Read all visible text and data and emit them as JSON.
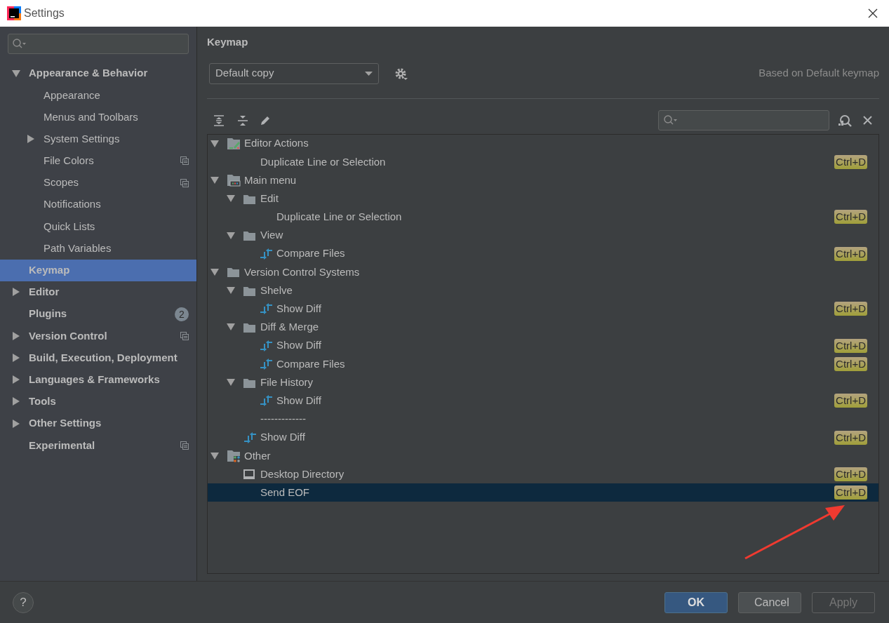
{
  "window": {
    "title": "Settings"
  },
  "sidebar": {
    "items": [
      {
        "label": "Appearance & Behavior",
        "expanded": true,
        "selected": false,
        "children": [
          {
            "label": "Appearance",
            "selected": false
          },
          {
            "label": "Menus and Toolbars",
            "selected": false
          },
          {
            "label": "System Settings",
            "expanded": false,
            "selected": false
          },
          {
            "label": "File Colors",
            "selected": false,
            "project_level": true
          },
          {
            "label": "Scopes",
            "selected": false,
            "project_level": true
          },
          {
            "label": "Notifications",
            "selected": false
          },
          {
            "label": "Quick Lists",
            "selected": false
          },
          {
            "label": "Path Variables",
            "selected": false
          }
        ]
      },
      {
        "label": "Keymap",
        "selected": true
      },
      {
        "label": "Editor",
        "expanded": false,
        "selected": false
      },
      {
        "label": "Plugins",
        "selected": false,
        "badge": "2"
      },
      {
        "label": "Version Control",
        "expanded": false,
        "selected": false,
        "project_level": true
      },
      {
        "label": "Build, Execution, Deployment",
        "expanded": false,
        "selected": false
      },
      {
        "label": "Languages & Frameworks",
        "expanded": false,
        "selected": false
      },
      {
        "label": "Tools",
        "expanded": false,
        "selected": false
      },
      {
        "label": "Other Settings",
        "expanded": false,
        "selected": false
      },
      {
        "label": "Experimental",
        "selected": false,
        "project_level": true
      }
    ]
  },
  "page": {
    "title": "Keymap",
    "keymap_select": {
      "value": "Default copy"
    },
    "based_on": "Based on Default keymap"
  },
  "tree": [
    {
      "label": "Editor Actions",
      "kind": "editor_group",
      "expanded": true,
      "selected": false,
      "children": [
        {
          "label": "Duplicate Line or Selection",
          "kind": "action",
          "selected": false,
          "shortcut": "Ctrl+D"
        }
      ]
    },
    {
      "label": "Main menu",
      "kind": "menu_group",
      "expanded": true,
      "selected": false,
      "children": [
        {
          "label": "Edit",
          "kind": "folder",
          "expanded": true,
          "selected": false,
          "children": [
            {
              "label": "Duplicate Line or Selection",
              "kind": "action",
              "selected": false,
              "shortcut": "Ctrl+D"
            }
          ]
        },
        {
          "label": "View",
          "kind": "folder",
          "expanded": true,
          "selected": false,
          "children": [
            {
              "label": "Compare Files",
              "kind": "diff",
              "selected": false,
              "shortcut": "Ctrl+D"
            }
          ]
        }
      ]
    },
    {
      "label": "Version Control Systems",
      "kind": "folder",
      "expanded": true,
      "selected": false,
      "children": [
        {
          "label": "Shelve",
          "kind": "folder",
          "expanded": true,
          "selected": false,
          "children": [
            {
              "label": "Show Diff",
              "kind": "diff",
              "selected": false,
              "shortcut": "Ctrl+D"
            }
          ]
        },
        {
          "label": "Diff & Merge",
          "kind": "folder",
          "expanded": true,
          "selected": false,
          "children": [
            {
              "label": "Show Diff",
              "kind": "diff",
              "selected": false,
              "shortcut": "Ctrl+D"
            },
            {
              "label": "Compare Files",
              "kind": "diff",
              "selected": false,
              "shortcut": "Ctrl+D"
            }
          ]
        },
        {
          "label": "File History",
          "kind": "folder",
          "expanded": true,
          "selected": false,
          "children": [
            {
              "label": "Show Diff",
              "kind": "diff",
              "selected": false,
              "shortcut": "Ctrl+D"
            }
          ]
        },
        {
          "label": "-------------",
          "kind": "separator",
          "selected": false
        },
        {
          "label": "Show Diff",
          "kind": "diff",
          "selected": false,
          "shortcut": "Ctrl+D"
        }
      ]
    },
    {
      "label": "Other",
      "kind": "other_group",
      "expanded": true,
      "selected": false,
      "children": [
        {
          "label": "Desktop Directory",
          "kind": "desktop",
          "selected": false,
          "shortcut": "Ctrl+D"
        },
        {
          "label": "Send EOF",
          "kind": "action",
          "selected": true,
          "shortcut": "Ctrl+D"
        }
      ]
    }
  ],
  "annotations": [
    {
      "kind": "arrow"
    }
  ],
  "footer": {
    "help": "?",
    "buttons": [
      {
        "label": "OK",
        "kind": "default",
        "disabled": false
      },
      {
        "label": "Cancel",
        "kind": "normal",
        "disabled": false
      },
      {
        "label": "Apply",
        "kind": "normal",
        "disabled": true
      }
    ]
  }
}
